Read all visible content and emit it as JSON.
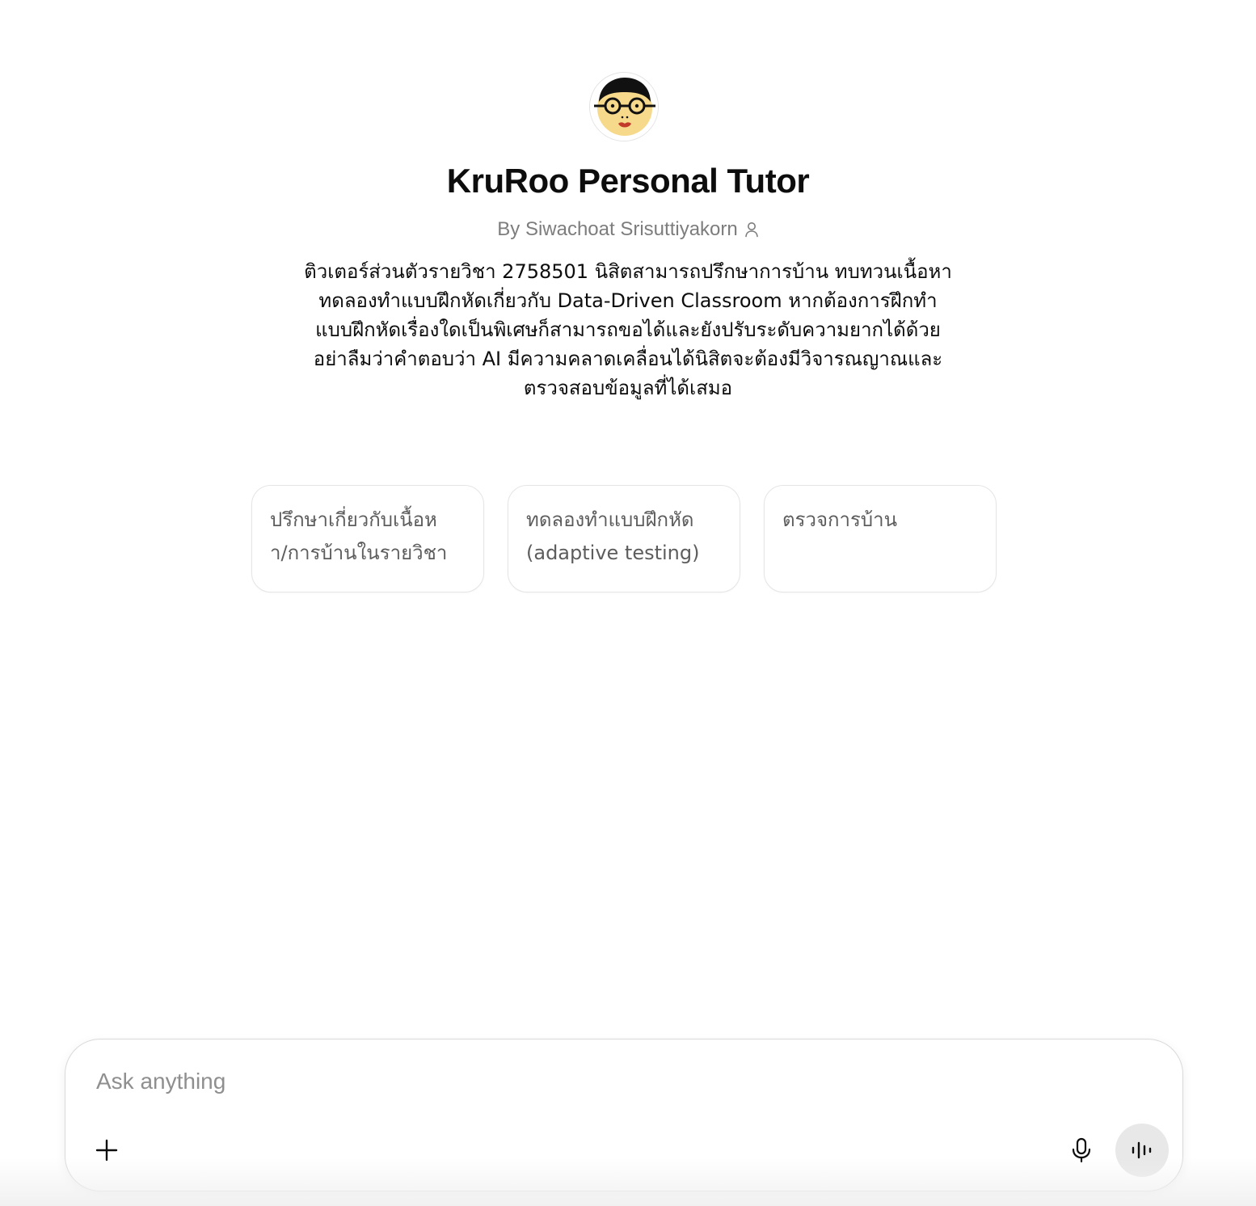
{
  "gpt": {
    "name": "KruRoo Personal Tutor",
    "author": "By Siwachoat Srisuttiyakorn",
    "description_lines": [
      "ติวเตอร์ส่วนตัวรายวิชา 2758501 นิสิตสามารถปรึกษาการบ้าน ทบทวนเนื้อหา",
      "ทดลองทำแบบฝึกหัดเกี่ยวกับ Data-Driven Classroom หากต้องการฝึกทำ",
      "แบบฝึกหัดเรื่องใดเป็นพิเศษก็สามารถขอได้และยังปรับระดับความยากได้ด้วย",
      "อย่าลืมว่าคำตอบว่า AI มีความคลาดเคลื่อนได้นิสิตจะต้องมีวิจารณญาณและ",
      "ตรวจสอบข้อมูลที่ได้เสมอ"
    ]
  },
  "starters": [
    {
      "lines": [
        "ปรึกษาเกี่ยวกับเนื้อห",
        "า/การบ้านในรายวิชา"
      ]
    },
    {
      "lines": [
        "ทดลองทำแบบฝึกหัด",
        "(adaptive testing)"
      ]
    },
    {
      "lines": [
        "ตรวจการบ้าน"
      ]
    }
  ],
  "composer": {
    "placeholder": "Ask anything",
    "value": ""
  },
  "icons": {
    "avatar": "cartoon-tutor-face",
    "author": "person-icon",
    "attach": "plus-icon",
    "dictate": "microphone-icon",
    "voice": "voice-waveform-icon"
  },
  "colors": {
    "title": "#0d0d0d",
    "muted": "#7d7d7d",
    "card_border": "#e5e5e5",
    "voice_button_bg": "#e8e8e8"
  }
}
